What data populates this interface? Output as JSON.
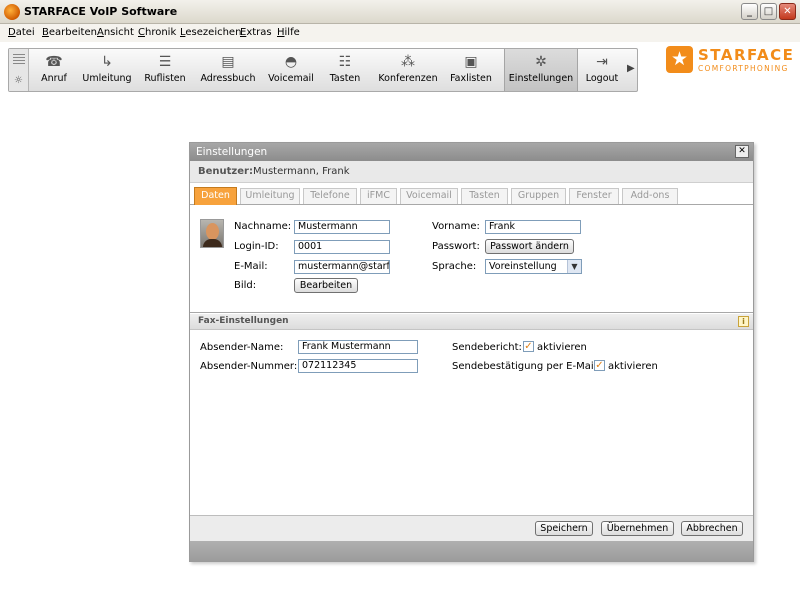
{
  "window": {
    "title": "STARFACE VoIP Software"
  },
  "menu": [
    {
      "label": "Datei",
      "u": "D",
      "rest": "atei"
    },
    {
      "label": "Bearbeiten",
      "u": "B",
      "rest": "earbeiten"
    },
    {
      "label": "Ansicht",
      "u": "A",
      "rest": "nsicht"
    },
    {
      "label": "Chronik",
      "u": "C",
      "rest": "hronik"
    },
    {
      "label": "Lesezeichen",
      "u": "L",
      "rest": "esezeichen"
    },
    {
      "label": "Extras",
      "u": "E",
      "rest": "xtras"
    },
    {
      "label": "Hilfe",
      "u": "H",
      "rest": "ilfe"
    }
  ],
  "toolbar": {
    "items": [
      {
        "label": "Anruf",
        "icon": "phone-handset-icon"
      },
      {
        "label": "Umleitung",
        "icon": "redirect-icon"
      },
      {
        "label": "Ruflisten",
        "icon": "list-icon"
      },
      {
        "label": "Adressbuch",
        "icon": "address-book-icon"
      },
      {
        "label": "Voicemail",
        "icon": "voicemail-icon"
      },
      {
        "label": "Tasten",
        "icon": "keys-icon"
      },
      {
        "label": "Konferenzen",
        "icon": "conference-icon"
      },
      {
        "label": "Faxlisten",
        "icon": "fax-icon"
      },
      {
        "label": "Einstellungen",
        "icon": "settings-icon"
      },
      {
        "label": "Logout",
        "icon": "logout-icon"
      }
    ],
    "active": "Einstellungen"
  },
  "logo": {
    "name": "STARFACE",
    "tagline": "COMFORTPHONING",
    "color": "#f28c1a"
  },
  "dialog": {
    "title": "Einstellungen",
    "user_label": "Benutzer:",
    "user_value": "Mustermann, Frank",
    "tabs": [
      "Daten",
      "Umleitung",
      "Telefone",
      "iFMC",
      "Voicemail",
      "Tasten",
      "Gruppen",
      "Fenster",
      "Add-ons"
    ],
    "active_tab": "Daten",
    "data": {
      "nachname_label": "Nachname:",
      "nachname_value": "Mustermann",
      "login_label": "Login-ID:",
      "login_value": "0001",
      "email_label": "E-Mail:",
      "email_value": "mustermann@starfa",
      "bild_label": "Bild:",
      "bild_button": "Bearbeiten",
      "vorname_label": "Vorname:",
      "vorname_value": "Frank",
      "passwort_label": "Passwort:",
      "passwort_button": "Passwort ändern",
      "sprache_label": "Sprache:",
      "sprache_value": "Voreinstellung"
    },
    "fax": {
      "header": "Fax-Einstellungen",
      "absender_name_label": "Absender-Name:",
      "absender_name_value": "Frank Mustermann",
      "absender_nummer_label": "Absender-Nummer:",
      "absender_nummer_value": "072112345",
      "sendebericht_label": "Sendebericht:",
      "sendebericht_check": "aktivieren",
      "sendebestaetigung_label": "Sendebestätigung per E-Mail:",
      "sendebestaetigung_check": "aktivieren"
    },
    "footer": {
      "save": "Speichern",
      "apply": "Übernehmen",
      "cancel": "Abbrechen"
    }
  }
}
